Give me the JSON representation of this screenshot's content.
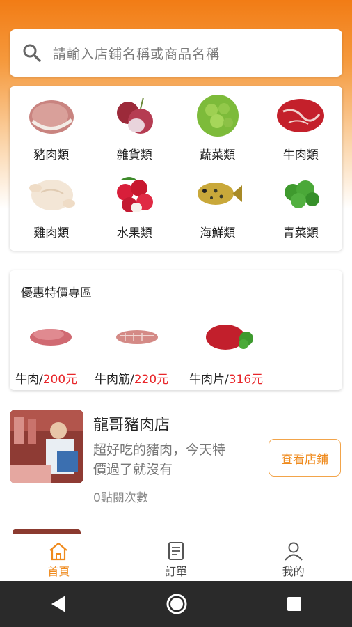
{
  "search": {
    "placeholder": "請輸入店鋪名稱或商品名稱"
  },
  "categories": [
    {
      "label": "豬肉類",
      "icon": "pork-icon"
    },
    {
      "label": "雜貨類",
      "icon": "onion-icon"
    },
    {
      "label": "蔬菜類",
      "icon": "lettuce-icon"
    },
    {
      "label": "牛肉類",
      "icon": "beef-icon"
    },
    {
      "label": "雞肉類",
      "icon": "chicken-icon"
    },
    {
      "label": "水果類",
      "icon": "lychee-icon"
    },
    {
      "label": "海鮮類",
      "icon": "fish-icon"
    },
    {
      "label": "青菜類",
      "icon": "greens-icon"
    }
  ],
  "promo": {
    "title": "優惠特價專區",
    "items": [
      {
        "name": "牛肉/",
        "price": "200元"
      },
      {
        "name": "牛肉筋/",
        "price": "220元"
      },
      {
        "name": "牛肉片/",
        "price": "316元"
      }
    ]
  },
  "shop": {
    "name": "龍哥豬肉店",
    "desc": "超好吃的豬肉，今天特價過了就沒有",
    "views": "0點閱次數",
    "button": "查看店鋪"
  },
  "nav": {
    "home": "首頁",
    "orders": "訂單",
    "mine": "我的"
  },
  "colors": {
    "accent": "#ef8a1c",
    "price": "#e8262a"
  }
}
